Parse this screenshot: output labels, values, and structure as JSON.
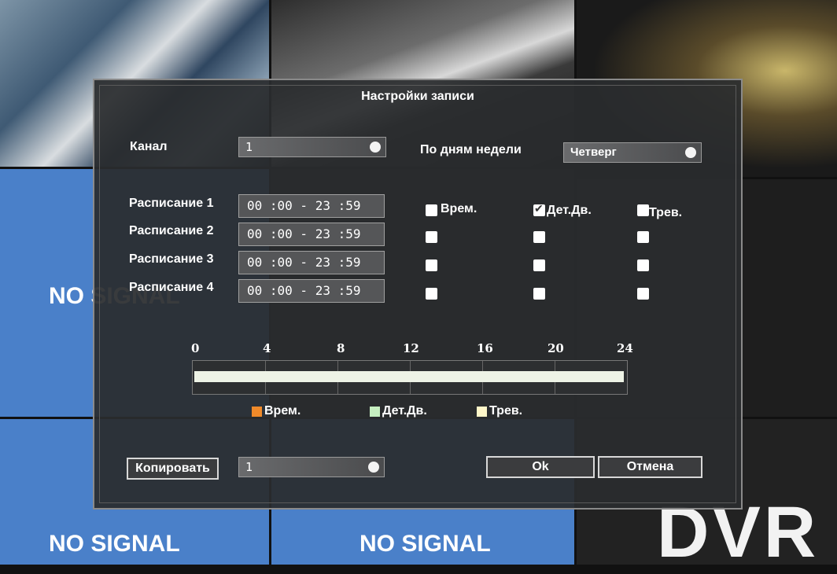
{
  "background": {
    "no_signal": [
      "NO SIGNAL",
      "NO SIGNAL",
      "NO SIGNAL"
    ],
    "logo": "DVR"
  },
  "dialog": {
    "title": "Настройки записи",
    "channel": {
      "label": "Канал",
      "value": "1"
    },
    "weekday": {
      "label": "По дням недели",
      "value": "Четверг"
    },
    "schedules": [
      {
        "label": "Расписание 1",
        "time": "00 :00 - 23 :59",
        "checks": [
          false,
          true,
          false
        ]
      },
      {
        "label": "Расписание 2",
        "time": "00 :00 - 23 :59",
        "checks": [
          false,
          false,
          false
        ]
      },
      {
        "label": "Расписание 3",
        "time": "00 :00 - 23 :59",
        "checks": [
          false,
          false,
          false
        ]
      },
      {
        "label": "Расписание 4",
        "time": "00 :00 - 23 :59",
        "checks": [
          false,
          false,
          false
        ]
      }
    ],
    "check_headers": [
      "Врем.",
      "Дет.Дв.",
      "Трев."
    ],
    "timeline": {
      "ticks": [
        "0",
        "4",
        "8",
        "12",
        "16",
        "20",
        "24"
      ],
      "fill_start_hour": 0,
      "fill_end_hour": 24
    },
    "legend": [
      {
        "label": "Врем.",
        "color": "#f08a2a"
      },
      {
        "label": "Дет.Дв.",
        "color": "#c6efc0"
      },
      {
        "label": "Трев.",
        "color": "#fff6c8"
      }
    ],
    "copy": {
      "button": "Копировать",
      "value": "1"
    },
    "ok": "Ok",
    "cancel": "Отмена"
  }
}
